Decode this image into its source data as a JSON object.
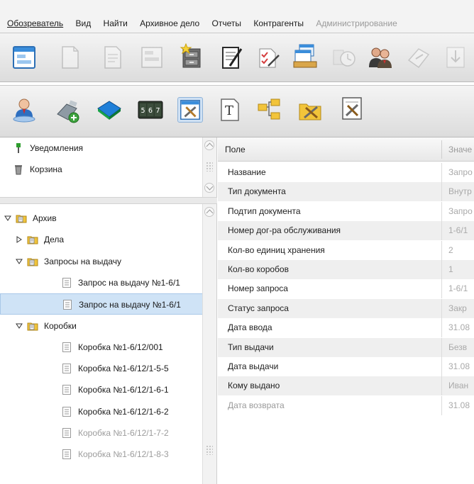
{
  "menu": {
    "items": [
      "Обозреватель",
      "Вид",
      "Найти",
      "Архивное дело",
      "Отчеты",
      "Контрагенты",
      "Администрирование"
    ]
  },
  "toolbar1": {
    "buttons": [
      {
        "icon": "form-window-icon",
        "state": "enabled"
      },
      {
        "icon": "blank-document-icon",
        "state": "disabled"
      },
      {
        "icon": "edit-document-icon",
        "state": "disabled"
      },
      {
        "icon": "document-form-icon",
        "state": "disabled"
      },
      {
        "icon": "archive-cabinet-new-icon",
        "state": "enabled"
      },
      {
        "icon": "notepad-pen-icon",
        "state": "enabled"
      },
      {
        "icon": "checklist-pen-icon",
        "state": "enabled"
      },
      {
        "icon": "window-stack-icon",
        "state": "enabled"
      },
      {
        "icon": "clock-icon",
        "state": "disabled"
      },
      {
        "icon": "users-icon",
        "state": "enabled"
      },
      {
        "icon": "forward-arrow-icon",
        "state": "disabled"
      },
      {
        "icon": "download-arrow-icon",
        "state": "disabled"
      }
    ]
  },
  "toolbar2": {
    "buttons": [
      {
        "icon": "user-badge-icon",
        "state": "enabled"
      },
      {
        "icon": "connector-icon",
        "state": "enabled"
      },
      {
        "icon": "books-icon",
        "state": "enabled"
      },
      {
        "icon": "counter-icon",
        "state": "enabled",
        "digits": [
          "5",
          "6",
          "7"
        ]
      },
      {
        "icon": "tools-window-icon",
        "state": "pressed"
      },
      {
        "icon": "text-template-icon",
        "state": "enabled"
      },
      {
        "icon": "folder-tree-icon",
        "state": "enabled"
      },
      {
        "icon": "folder-tools-icon",
        "state": "enabled"
      },
      {
        "icon": "document-tools-icon",
        "state": "enabled"
      }
    ]
  },
  "tree_top": {
    "items": [
      {
        "label": "Уведомления",
        "icon": "pin-icon"
      },
      {
        "label": "Корзина",
        "icon": "trash-icon"
      }
    ]
  },
  "tree": {
    "items": [
      {
        "label": "Архив",
        "icon": "archive-folder-icon",
        "caret": "expanded",
        "depth": 0,
        "selected": false,
        "faded": false
      },
      {
        "label": "Дела",
        "icon": "archive-folder-icon",
        "caret": "collapsed",
        "depth": 1,
        "selected": false,
        "faded": false
      },
      {
        "label": "Запросы на выдачу",
        "icon": "archive-folder-icon",
        "caret": "expanded",
        "depth": 1,
        "selected": false,
        "faded": false
      },
      {
        "label": "Запрос на выдачу №1-6/1",
        "icon": "document-lines-icon",
        "caret": "none",
        "depth": 3,
        "selected": false,
        "faded": false
      },
      {
        "label": "Запрос на выдачу №1-6/1",
        "icon": "document-lines-icon",
        "caret": "none",
        "depth": 3,
        "selected": true,
        "faded": false
      },
      {
        "label": "Коробки",
        "icon": "archive-folder-icon",
        "caret": "expanded",
        "depth": 1,
        "selected": false,
        "faded": false
      },
      {
        "label": "Коробка №1-6/12/001",
        "icon": "document-lines-icon",
        "caret": "none",
        "depth": 3,
        "selected": false,
        "faded": false
      },
      {
        "label": "Коробка №1-6/12/1-5-5",
        "icon": "document-lines-icon",
        "caret": "none",
        "depth": 3,
        "selected": false,
        "faded": false
      },
      {
        "label": "Коробка №1-6/12/1-6-1",
        "icon": "document-lines-icon",
        "caret": "none",
        "depth": 3,
        "selected": false,
        "faded": false
      },
      {
        "label": "Коробка №1-6/12/1-6-2",
        "icon": "document-lines-icon",
        "caret": "none",
        "depth": 3,
        "selected": false,
        "faded": false
      },
      {
        "label": "Коробка №1-6/12/1-7-2",
        "icon": "document-lines-icon",
        "caret": "none",
        "depth": 3,
        "selected": false,
        "faded": true
      },
      {
        "label": "Коробка №1-6/12/1-8-3",
        "icon": "document-lines-icon",
        "caret": "none",
        "depth": 3,
        "selected": false,
        "faded": true
      }
    ]
  },
  "grid": {
    "headers": {
      "field": "Поле",
      "value": "Значе"
    },
    "rows": [
      {
        "field": "Название",
        "value": "Запро",
        "faded": false
      },
      {
        "field": "Тип документа",
        "value": "Внутр",
        "faded": false
      },
      {
        "field": "Подтип документа",
        "value": "Запро",
        "faded": false
      },
      {
        "field": "Номер дог-ра обслуживания",
        "value": "1-6/1",
        "faded": false
      },
      {
        "field": "Кол-во единиц хранения",
        "value": "2",
        "faded": false
      },
      {
        "field": "Кол-во коробов",
        "value": "1",
        "faded": false
      },
      {
        "field": "Номер запроса",
        "value": "1-6/1",
        "faded": false
      },
      {
        "field": "Статус запроса",
        "value": "Закр",
        "faded": false
      },
      {
        "field": "Дата ввода",
        "value": "31.08",
        "faded": false
      },
      {
        "field": "Тип выдачи",
        "value": "Безв",
        "faded": false
      },
      {
        "field": "Дата выдачи",
        "value": "31.08",
        "faded": false
      },
      {
        "field": "Кому выдано",
        "value": "Иван",
        "faded": false
      },
      {
        "field": "Дата возврата",
        "value": "31.08",
        "faded": true
      }
    ]
  }
}
